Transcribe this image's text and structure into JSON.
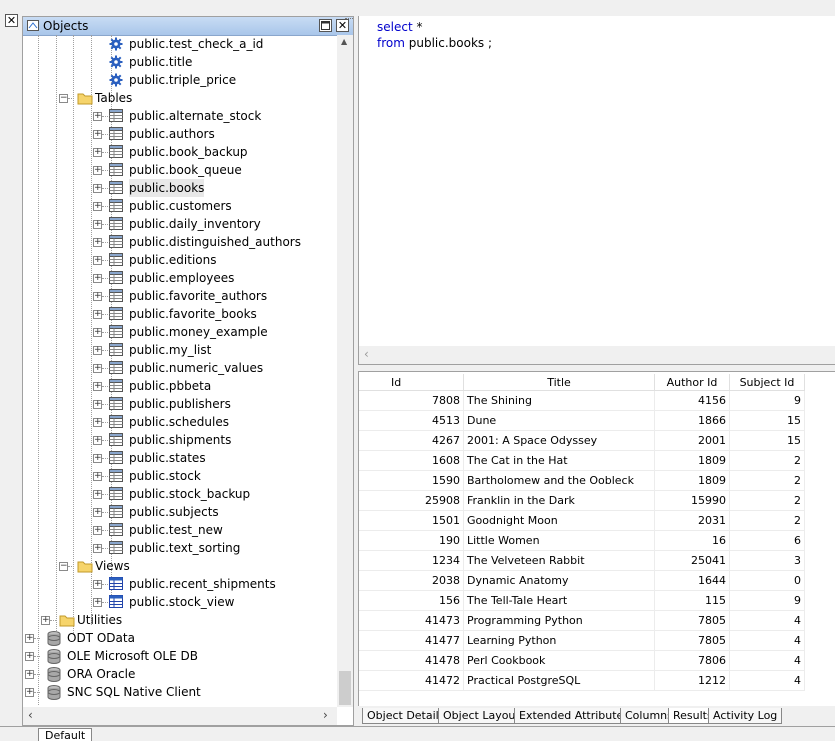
{
  "objects_panel": {
    "title": "Objects",
    "tree": [
      {
        "label": "public.test_check_a_id",
        "type": "trigger"
      },
      {
        "label": "public.title",
        "type": "trigger"
      },
      {
        "label": "public.triple_price",
        "type": "trigger"
      },
      {
        "label": "Tables",
        "type": "folder"
      },
      {
        "label": "public.alternate_stock",
        "type": "table"
      },
      {
        "label": "public.authors",
        "type": "table"
      },
      {
        "label": "public.book_backup",
        "type": "table"
      },
      {
        "label": "public.book_queue",
        "type": "table"
      },
      {
        "label": "public.books",
        "type": "table"
      },
      {
        "label": "public.customers",
        "type": "table"
      },
      {
        "label": "public.daily_inventory",
        "type": "table"
      },
      {
        "label": "public.distinguished_authors",
        "type": "table"
      },
      {
        "label": "public.editions",
        "type": "table"
      },
      {
        "label": "public.employees",
        "type": "table"
      },
      {
        "label": "public.favorite_authors",
        "type": "table"
      },
      {
        "label": "public.favorite_books",
        "type": "table"
      },
      {
        "label": "public.money_example",
        "type": "table"
      },
      {
        "label": "public.my_list",
        "type": "table"
      },
      {
        "label": "public.numeric_values",
        "type": "table"
      },
      {
        "label": "public.pbbeta",
        "type": "table"
      },
      {
        "label": "public.publishers",
        "type": "table"
      },
      {
        "label": "public.schedules",
        "type": "table"
      },
      {
        "label": "public.shipments",
        "type": "table"
      },
      {
        "label": "public.states",
        "type": "table"
      },
      {
        "label": "public.stock",
        "type": "table"
      },
      {
        "label": "public.stock_backup",
        "type": "table"
      },
      {
        "label": "public.subjects",
        "type": "table"
      },
      {
        "label": "public.test_new",
        "type": "table"
      },
      {
        "label": "public.text_sorting",
        "type": "table"
      },
      {
        "label": "Views",
        "type": "folder"
      },
      {
        "label": "public.recent_shipments",
        "type": "view"
      },
      {
        "label": "public.stock_view",
        "type": "view"
      },
      {
        "label": "Utilities",
        "type": "folder"
      },
      {
        "label": "ODT OData",
        "type": "db"
      },
      {
        "label": "OLE Microsoft OLE DB",
        "type": "db"
      },
      {
        "label": "ORA Oracle",
        "type": "db"
      },
      {
        "label": "SNC SQL Native Client",
        "type": "db"
      }
    ]
  },
  "editor": {
    "line1_kw": "select",
    "line1_rest": " *",
    "line2_kw": "from",
    "line2_rest": " public.books ;"
  },
  "results": {
    "columns": [
      "Id",
      "Title",
      "Author Id",
      "Subject Id"
    ],
    "rows": [
      [
        "7808",
        "The Shining",
        "4156",
        "9"
      ],
      [
        "4513",
        "Dune",
        "1866",
        "15"
      ],
      [
        "4267",
        "2001: A Space Odyssey",
        "2001",
        "15"
      ],
      [
        "1608",
        "The Cat in the Hat",
        "1809",
        "2"
      ],
      [
        "1590",
        "Bartholomew and the Oobleck",
        "1809",
        "2"
      ],
      [
        "25908",
        "Franklin in the Dark",
        "15990",
        "2"
      ],
      [
        "1501",
        "Goodnight Moon",
        "2031",
        "2"
      ],
      [
        "190",
        "Little Women",
        "16",
        "6"
      ],
      [
        "1234",
        "The Velveteen Rabbit",
        "25041",
        "3"
      ],
      [
        "2038",
        "Dynamic Anatomy",
        "1644",
        "0"
      ],
      [
        "156",
        "The Tell-Tale Heart",
        "115",
        "9"
      ],
      [
        "41473",
        "Programming Python",
        "7805",
        "4"
      ],
      [
        "41477",
        "Learning Python",
        "7805",
        "4"
      ],
      [
        "41478",
        "Perl Cookbook",
        "7806",
        "4"
      ],
      [
        "41472",
        "Practical PostgreSQL",
        "1212",
        "4"
      ]
    ]
  },
  "tabs": [
    "Object Details",
    "Object Layout",
    "Extended Attributes",
    "Columns",
    "Results",
    "Activity Log"
  ],
  "active_tab": "Results",
  "bottom_tab": "Default"
}
